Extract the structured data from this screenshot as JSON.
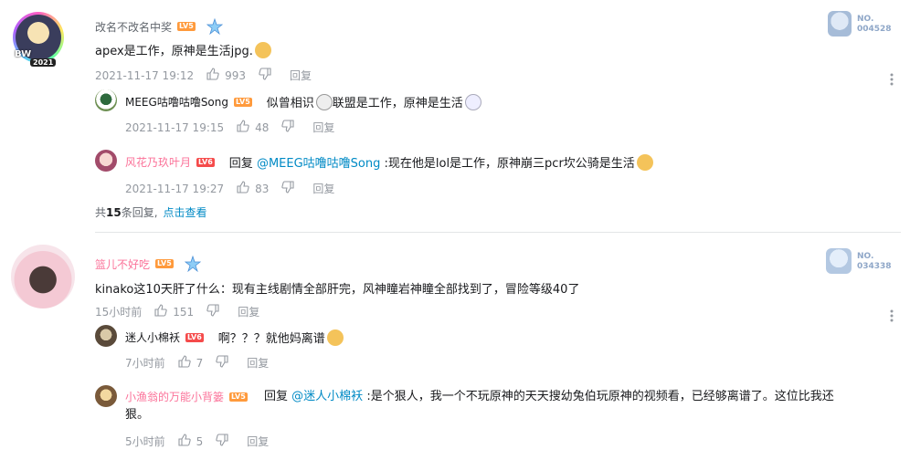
{
  "comments": [
    {
      "username": "改名不改名中奖",
      "level": "LV5",
      "content": "apex是工作，原神是生活jpg.",
      "time": "2021-11-17 19:12",
      "likes": "993",
      "reply_label": "回复",
      "fan_badge_label": "NO.",
      "fan_badge_num": "004528",
      "avatar_tag": "2021",
      "avatar_mark": "BW",
      "replies": [
        {
          "username": "MEEG咕噜咕噜Song",
          "level": "LV5",
          "content_a": "似曾相识",
          "content_b": "联盟是工作，原神是生活",
          "time": "2021-11-17 19:15",
          "likes": "48",
          "reply_label": "回复"
        },
        {
          "username": "风花乃玖叶月",
          "level": "LV6",
          "prefix": "回复",
          "mention": "@MEEG咕噜咕噜Song",
          "content": ":现在他是lol是工作，原神崩三pcr坎公骑是生活",
          "time": "2021-11-17 19:27",
          "likes": "83",
          "reply_label": "回复"
        }
      ],
      "summary_prefix": "共",
      "summary_count": "15",
      "summary_suffix": "条回复,",
      "summary_link": "点击查看"
    },
    {
      "username": "篮儿不好吃",
      "level": "LV5",
      "content": "kinako这10天肝了什么：现有主线剧情全部肝完，风神瞳岩神瞳全部找到了，冒险等级40了",
      "time": "15小时前",
      "likes": "151",
      "reply_label": "回复",
      "fan_badge_label": "NO.",
      "fan_badge_num": "034338",
      "replies": [
        {
          "username": "迷人小棉袄",
          "level": "LV6",
          "content": "啊？？？就他妈离谱",
          "time": "7小时前",
          "likes": "7",
          "reply_label": "回复"
        },
        {
          "username": "小渔翁的万能小背篓",
          "level": "LV5",
          "prefix": "回复",
          "mention": "@迷人小棉袄",
          "content_line1": ":是个狠人，我一个不玩原神的天天搜幼兔伯玩原神的视频看，已经够离谱了。这位比我还",
          "content_line2": "狠。",
          "time": "5小时前",
          "likes": "5",
          "reply_label": "回复"
        }
      ]
    }
  ]
}
